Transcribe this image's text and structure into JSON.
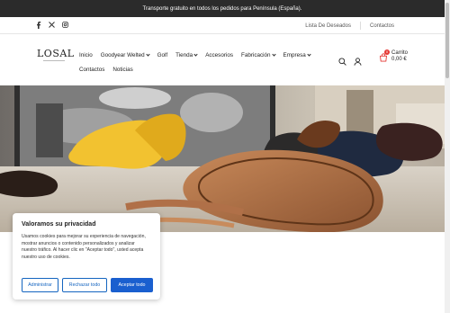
{
  "announcement": "Transporte gratuito en todos los pedidos para Península (España).",
  "social": [
    "facebook-icon",
    "x-icon",
    "instagram-icon"
  ],
  "util_links": [
    "Lista De Deseados",
    "Contactos"
  ],
  "logo": {
    "word": "LOSAL"
  },
  "nav": {
    "row1": [
      "Inicio",
      "Goodyear Welted",
      "Golf",
      "Tienda",
      "Accesorios",
      "Fabricación",
      "Empresa"
    ],
    "row2": [
      "Contactos",
      "Noticias"
    ]
  },
  "cart": {
    "label": "Carrito",
    "total": "0,00 €",
    "count": "0"
  },
  "cookie": {
    "title": "Valoramos su privacidad",
    "body": "Usamos cookies para mejorar su experiencia de navegación, mostrar anuncios o contenido personalizados y analizar nuestro tráfico. Al hacer clic en \"Aceptar todo\", usted acepta nuestro uso de cookies.",
    "btn_customize": "Administrar",
    "btn_reject": "Rechazar todo",
    "btn_accept": "Aceptar todo"
  },
  "colors": {
    "topbar": "#2b2b2b",
    "accent": "#1a5fcf",
    "badge": "#e53935"
  }
}
